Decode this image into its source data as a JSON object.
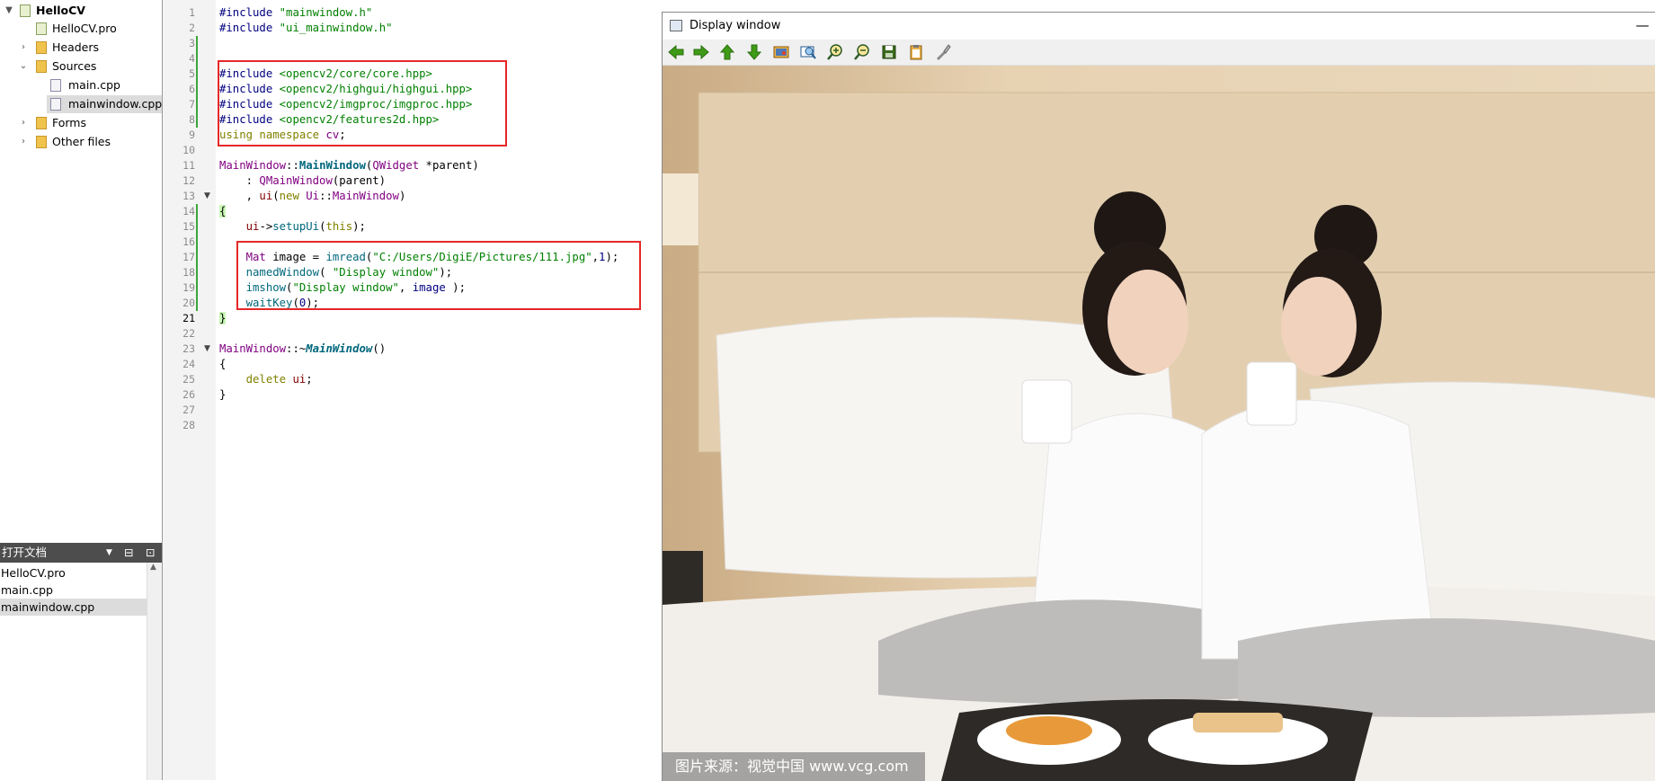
{
  "project_tree": {
    "items": [
      {
        "label": "HelloCV",
        "expanded": "true"
      },
      {
        "label": "HelloCV.pro"
      },
      {
        "label": "Headers",
        "expanded": "false"
      },
      {
        "label": "Sources",
        "expanded": "true"
      },
      {
        "label": "main.cpp"
      },
      {
        "label": "mainwindow.cpp",
        "selected": "true"
      },
      {
        "label": "Forms",
        "expanded": "false"
      },
      {
        "label": "Other files",
        "expanded": "false"
      }
    ]
  },
  "open_documents": {
    "title": "打开文档",
    "items": [
      "HelloCV.pro",
      "main.cpp",
      "mainwindow.cpp"
    ],
    "selected": "mainwindow.cpp"
  },
  "editor": {
    "line_numbers": [
      "1",
      "2",
      "3",
      "4",
      "5",
      "6",
      "7",
      "8",
      "9",
      "10",
      "11",
      "12",
      "13",
      "14",
      "15",
      "16",
      "17",
      "18",
      "19",
      "20",
      "21",
      "22",
      "23",
      "24",
      "25",
      "26",
      "27",
      "28"
    ],
    "current_line": "21",
    "lines": {
      "l1": {
        "a": "#include ",
        "b": "\"mainwindow.h\""
      },
      "l2": {
        "a": "#include ",
        "b": "\"ui_mainwindow.h\""
      },
      "l5": {
        "a": "#include ",
        "b": "<opencv2/core/core.hpp>"
      },
      "l6": {
        "a": "#include ",
        "b": "<opencv2/highgui/highgui.hpp>"
      },
      "l7": {
        "a": "#include ",
        "b": "<opencv2/imgproc/imgproc.hpp>"
      },
      "l8": {
        "a": "#include ",
        "b": "<opencv2/features2d.hpp>"
      },
      "l9": {
        "a": "using namespace ",
        "b": "cv",
        "c": ";"
      },
      "l11": {
        "a": "MainWindow",
        "b": "::",
        "c": "MainWindow",
        "d": "(",
        "e": "QWidget",
        "f": " *parent)"
      },
      "l12": {
        "a": "    : ",
        "b": "QMainWindow",
        "c": "(parent)"
      },
      "l13": {
        "a": "    , ",
        "b": "ui",
        "c": "(",
        "d": "new ",
        "e": "Ui",
        "f": "::",
        "g": "MainWindow",
        "h": ")"
      },
      "l14": {
        "a": "{"
      },
      "l15": {
        "a": "    ",
        "b": "ui",
        "c": "->",
        "d": "setupUi",
        "e": "(",
        "f": "this",
        "g": ");"
      },
      "l17": {
        "a": "    ",
        "b": "Mat",
        "c": " image = ",
        "d": "imread",
        "e": "(",
        "f": "\"C:/Users/DigiE/Pictures/111.jpg\"",
        "g": ",",
        "h": "1",
        "i": ");"
      },
      "l18": {
        "a": "    ",
        "b": "namedWindow",
        "c": "( ",
        "d": "\"Display window\"",
        "e": ");"
      },
      "l19": {
        "a": "    ",
        "b": "imshow",
        "c": "(",
        "d": "\"Display window\"",
        "e": ", ",
        "f": "image",
        "g": " );"
      },
      "l20": {
        "a": "    ",
        "b": "waitKey",
        "c": "(",
        "d": "0",
        "e": ");"
      },
      "l21": {
        "a": "}"
      },
      "l23": {
        "a": "MainWindow",
        "b": "::~",
        "c": "MainWindow",
        "d": "()"
      },
      "l24": {
        "a": "{"
      },
      "l25": {
        "a": "    ",
        "b": "delete ",
        "c": "ui",
        "d": ";"
      },
      "l26": {
        "a": "}"
      }
    }
  },
  "display_window": {
    "title": "Display window",
    "minimize_glyph": "—",
    "toolbar": [
      "pan-left-icon",
      "pan-right-icon",
      "pan-up-icon",
      "pan-down-icon",
      "zoom-image-icon",
      "zoom-fit-icon",
      "zoom-in-icon",
      "zoom-out-icon",
      "save-icon",
      "copy-icon",
      "properties-icon"
    ],
    "watermark": "图片来源：视觉中国 www.vcg.com"
  }
}
